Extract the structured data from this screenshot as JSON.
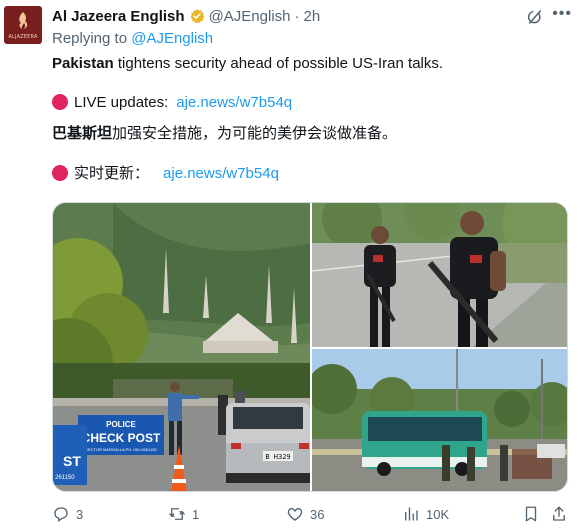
{
  "account": {
    "name": "Al Jazeera English",
    "handle": "@AJEnglish",
    "time": "2h",
    "separator": "·",
    "avatar_text": "ALJAZEERA"
  },
  "reply": {
    "prefix": "Replying to",
    "to": "@AJEnglish"
  },
  "tweet": {
    "line1_bold": "Pakistan",
    "line1_rest": " tightens security ahead of possible US-Iran talks.",
    "live_label": "LIVE updates:",
    "link1": "aje.news/w7b54q",
    "zh_bold": "巴基斯坦",
    "zh_rest": "加强安全措施，为可能的美伊会谈做准备。",
    "zh_live_label": "实时更新：",
    "link2": "aje.news/w7b54q"
  },
  "media": {
    "photo1_sign_line1": "POLICE",
    "photo1_sign_line2": "CHECK POST",
    "photo1_sign_small": "SECTOR MARGALLA  PH: 051-9261150",
    "photo1_left_sign": "ST",
    "photo1_left_number": "261150",
    "photo1_plate": "B H329"
  },
  "actions": {
    "replies": "3",
    "reposts": "1",
    "likes": "36",
    "views": "10K"
  },
  "colors": {
    "link": "#1d9bf0",
    "muted": "#536471",
    "bullet": "#e0245e",
    "verified": "#e8b62a",
    "avatar_bg": "#7a1f1f"
  }
}
